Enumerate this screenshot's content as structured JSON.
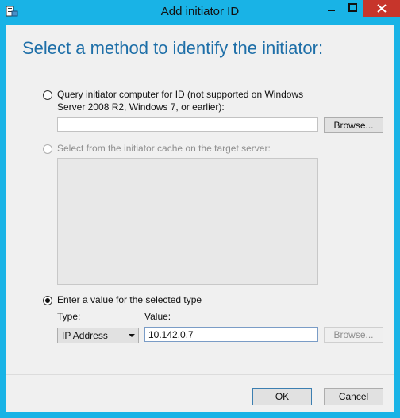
{
  "window": {
    "title": "Add initiator ID",
    "accent_color": "#19b3e6",
    "close_color": "#c7352b"
  },
  "heading": "Select a method to identify the initiator:",
  "query_option": {
    "label_line1": "Query initiator computer for ID (not supported on Windows",
    "label_line2": "Server 2008 R2, Windows 7, or earlier):",
    "selected": false,
    "input_value": "",
    "browse_label": "Browse..."
  },
  "cache_option": {
    "label": "Select from the initiator cache on the target server:",
    "enabled": false,
    "selected": false
  },
  "manual_option": {
    "label": "Enter a value for the selected type",
    "selected": true,
    "type_label": "Type:",
    "value_label": "Value:",
    "type_selected": "IP Address",
    "value": "10.142.0.7",
    "browse_label": "Browse...",
    "browse_enabled": false
  },
  "footer": {
    "ok_label": "OK",
    "cancel_label": "Cancel"
  },
  "icons": {
    "app": "initiator-app-icon",
    "minimize": "minimize-icon",
    "maximize": "maximize-icon",
    "close": "close-icon",
    "dropdown": "chevron-down-icon"
  }
}
